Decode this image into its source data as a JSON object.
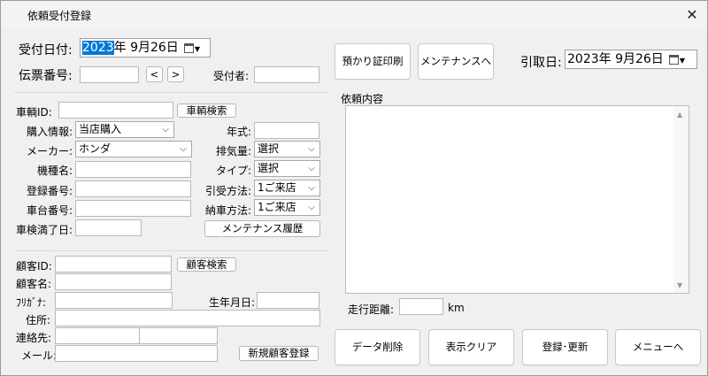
{
  "window": {
    "title": "依頼受付登録",
    "close_glyph": "✕"
  },
  "header": {
    "reception_date_label": "受付日付:",
    "reception_date_year_selected": "2023",
    "reception_date_rest": "年  9月26日",
    "slip_no_label": "伝票番号:",
    "prev_glyph": "<",
    "next_glyph": ">",
    "receiver_label": "受付者:",
    "print_receipt_button": "預かり証印刷",
    "maintenance_button": "メンテナンスへ",
    "pickup_date_label": "引取日:",
    "pickup_date_value": "2023年  9月26日"
  },
  "vehicle": {
    "vehicle_id_label": "車輌ID:",
    "vehicle_search_button": "車輌検索",
    "purchase_info_label": "購入情報:",
    "purchase_info_value": "当店購入",
    "year_label": "年式:",
    "maker_label": "メーカー:",
    "maker_value": "ホンダ",
    "displacement_label": "排気量:",
    "displacement_value": "選択",
    "model_name_label": "機種名:",
    "type_label": "タイプ:",
    "type_value": "選択",
    "reg_no_label": "登録番号:",
    "pickup_method_label": "引受方法:",
    "pickup_method_value": "1ご来店",
    "chassis_no_label": "車台番号:",
    "delivery_method_label": "納車方法:",
    "delivery_method_value": "1ご来店",
    "inspection_expiry_label": "車検満了日:",
    "maintenance_history_button": "メンテナンス履歴"
  },
  "customer": {
    "customer_id_label": "顧客ID:",
    "customer_search_button": "顧客検索",
    "customer_name_label": "顧客名:",
    "furigana_label": "ﾌﾘｶﾞﾅ:",
    "birthdate_label": "生年月日:",
    "address_label": "住所:",
    "contact_label": "連絡先:",
    "email_label": "メール:",
    "new_customer_button": "新規顧客登録"
  },
  "request": {
    "content_label": "依頼内容",
    "mileage_label": "走行距離:",
    "mileage_unit": "km"
  },
  "footer": {
    "delete_button": "データ削除",
    "clear_button": "表示クリア",
    "save_button": "登録･更新",
    "menu_button": "メニューへ"
  },
  "icons": {
    "dropdown": "chevron-down-icon",
    "calendar": "calendar-icon",
    "scroll_up": "▲",
    "scroll_down": "▼"
  },
  "colors": {
    "selection": "#0078d7",
    "window_bg": "#f0f0f0"
  }
}
